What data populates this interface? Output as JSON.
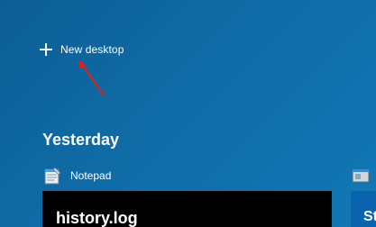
{
  "new_desktop": {
    "label": "New desktop",
    "icon": "plus-icon"
  },
  "timeline": {
    "heading": "Yesterday",
    "windows": [
      {
        "app_name": "Notepad",
        "icon": "notepad-icon",
        "thumbnail_text": "history.log"
      },
      {
        "app_name": "",
        "icon": "app-icon",
        "thumbnail_text": "St"
      }
    ]
  },
  "annotation": {
    "arrow_color": "#e0201c"
  }
}
